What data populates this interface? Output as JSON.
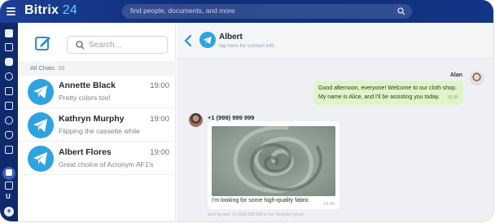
{
  "app": {
    "brand_name": "Bitrix",
    "brand_number": "24",
    "global_search_placeholder": "find people, documents, and more"
  },
  "rail": {
    "user_letter": "U",
    "add_symbol": "+"
  },
  "chat_list": {
    "search_placeholder": "Search...",
    "all_chats_label": "All Chats",
    "all_chats_count": "39",
    "chats": [
      {
        "name": "Annette Black",
        "time": "19:00",
        "preview": "Pretty colors too!",
        "icon": "telegram-icon"
      },
      {
        "name": "Kathryn Murphy",
        "time": "19:00",
        "preview": "Flipping the cassette while",
        "icon": "telegram-icon"
      },
      {
        "name": "Albert Flores",
        "time": "19:00",
        "preview": "Great choice of Acronym AF1's",
        "icon": "telegram-icon"
      }
    ]
  },
  "conversation": {
    "title": "Albert",
    "subtitle": "tap here for contact info",
    "messages": [
      {
        "sender": "Alan",
        "direction": "out",
        "text_line1": "Good afternoon, everyone! Welcome to our cloth shop.",
        "text_line2": "My name is Alice, and I'll be assisting you today.",
        "time": "18:30"
      },
      {
        "sender": "+1 (999) 999 999",
        "direction": "in",
        "attachment": "fabric-photo",
        "text": "I'm looking for some high-quality fabric",
        "time": "19:00"
      }
    ],
    "footer_note": "Sent by user +1 (999) 999 999 to the Telegram group"
  },
  "colors": {
    "topbar": "#123585",
    "rail": "#0f2a6b",
    "accent": "#2fa3e0",
    "outgoing_bubble": "#dff5c9"
  }
}
